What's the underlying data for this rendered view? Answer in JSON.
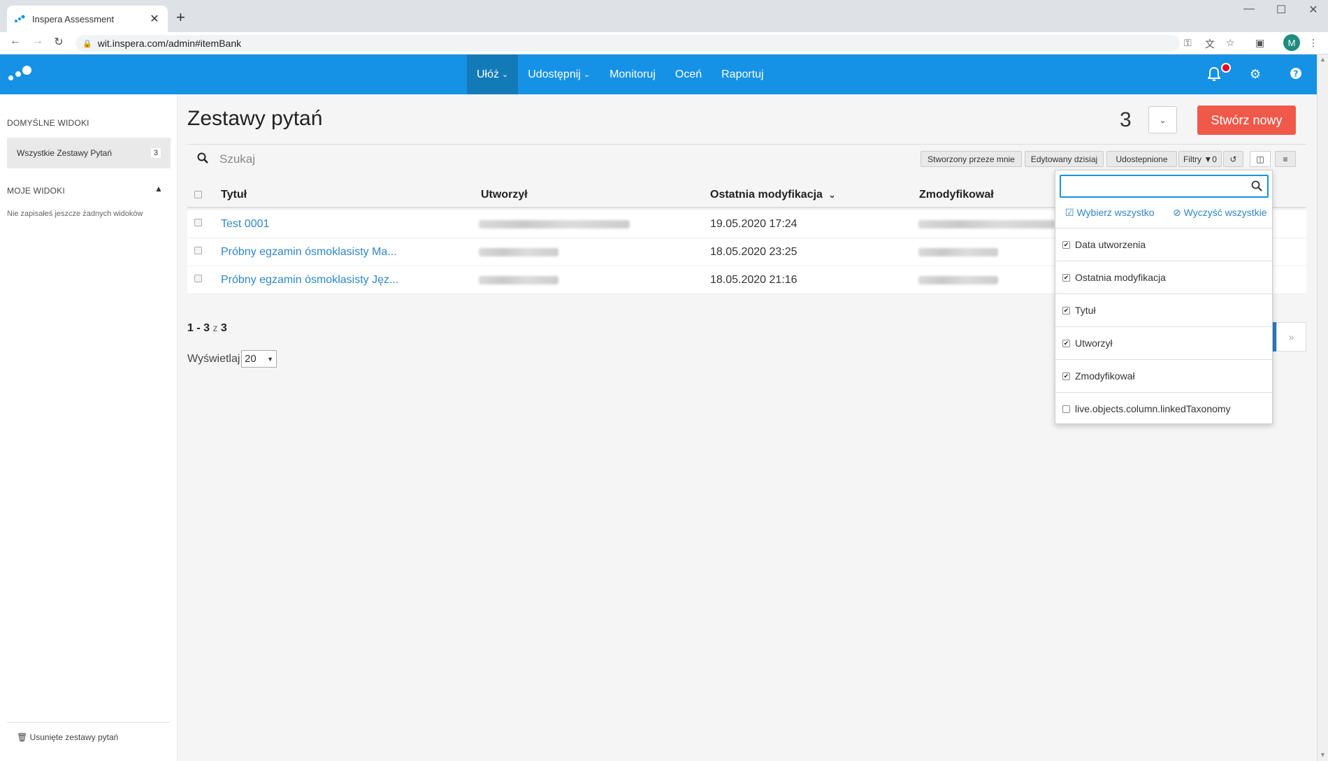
{
  "browser": {
    "tab_title": "Inspera Assessment",
    "tab_close": "✕",
    "new_tab": "+",
    "url": "wit.inspera.com/admin#itemBank",
    "profile_initial": "M",
    "window_controls": [
      "—",
      "☐",
      "✕"
    ]
  },
  "header": {
    "nav": [
      {
        "label": "Ułóż",
        "has_caret": true,
        "active": true
      },
      {
        "label": "Udostępnij",
        "has_caret": true,
        "active": false
      },
      {
        "label": "Monitoruj",
        "has_caret": false,
        "active": false
      },
      {
        "label": "Oceń",
        "has_caret": false,
        "active": false
      },
      {
        "label": "Raportuj",
        "has_caret": false,
        "active": false
      }
    ],
    "icons": [
      "bell-icon",
      "gear-icon",
      "help-icon"
    ],
    "accent_color": "#1592e6",
    "notification_color": "#e60026"
  },
  "sidebar": {
    "default_views_heading": "DOMYŚLNE WIDOKI",
    "all_sets_label": "Wszystkie Zestawy Pytań",
    "all_sets_count": "3",
    "my_views_heading": "MOJE WIDOKI",
    "my_views_empty": "Nie zapisałeś jeszcze żadnych widoków",
    "deleted_label": "Usunięte zestawy pytań"
  },
  "main": {
    "title": "Zestawy pytań",
    "count": "3",
    "create_button": "Stwórz nowy",
    "create_color": "#f0594a",
    "search_placeholder": "Szukaj",
    "filters": {
      "created_by_me": "Stworzony przeze mnie",
      "edited_today": "Edytowany dzisiaj",
      "shared": "Udostepnione",
      "filters_label": "Filtry",
      "filters_count": "0"
    }
  },
  "table": {
    "columns": [
      "Tytuł",
      "Utworzył",
      "Ostatnia modyfikacja",
      "Zmodyfikował"
    ],
    "rows": [
      {
        "title": "Test 0001",
        "modified": "19.05.2020 17:24"
      },
      {
        "title": "Próbny egzamin ósmoklasisty Ma...",
        "modified": "18.05.2020 23:25"
      },
      {
        "title": "Próbny egzamin ósmoklasisty Jęz...",
        "modified": "18.05.2020 21:16"
      }
    ],
    "link_color": "#2e86c9"
  },
  "pagination": {
    "range": "1 - 3",
    "of": "z",
    "total": "3",
    "show_label": "Wyświetlaj",
    "page_size": "20",
    "next": "»"
  },
  "column_dropdown": {
    "select_all": "Wybierz wszystko",
    "clear_all": "Wyczyść wszystkie",
    "items": [
      {
        "label": "Data utworzenia",
        "checked": true
      },
      {
        "label": "Ostatnia modyfikacja",
        "checked": true
      },
      {
        "label": "Tytuł",
        "checked": true
      },
      {
        "label": "Utworzył",
        "checked": true
      },
      {
        "label": "Zmodyfikował",
        "checked": true
      },
      {
        "label": "live.objects.column.linkedTaxonomy",
        "checked": false
      }
    ]
  }
}
